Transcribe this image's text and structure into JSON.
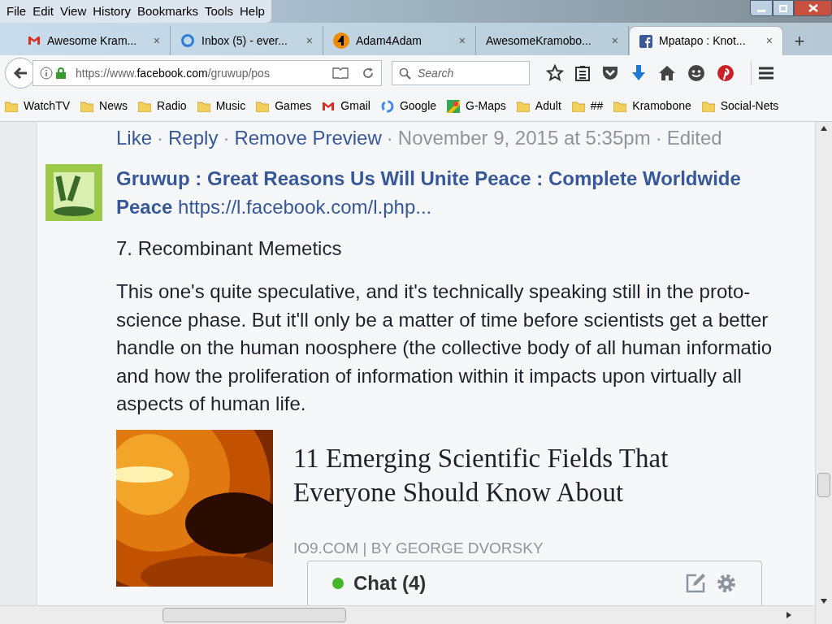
{
  "menu": [
    "File",
    "Edit",
    "View",
    "History",
    "Bookmarks",
    "Tools",
    "Help"
  ],
  "tabs": [
    {
      "title": "Awesome Kram...",
      "kind": "mail",
      "close": "×",
      "selected": false
    },
    {
      "title": "Inbox (5) - ever...",
      "kind": "ring",
      "close": "×",
      "selected": false
    },
    {
      "title": "Adam4Adam",
      "kind": "logo",
      "close": "×",
      "selected": false
    },
    {
      "title": "AwesomeKramobo...",
      "kind": "plain",
      "close": "×",
      "selected": false
    },
    {
      "title": "Mpatapo : Knot...",
      "kind": "social",
      "close": "×",
      "selected": true
    }
  ],
  "tab_new": "+",
  "url": {
    "prefix": "https://www.",
    "domain": "facebook.com",
    "path": "/gruwup/pos"
  },
  "search": {
    "placeholder": "Search"
  },
  "bookmarks": [
    {
      "label": "WatchTV",
      "kind": "folder"
    },
    {
      "label": "News",
      "kind": "folder"
    },
    {
      "label": "Radio",
      "kind": "folder"
    },
    {
      "label": "Music",
      "kind": "folder"
    },
    {
      "label": "Games",
      "kind": "folder"
    },
    {
      "label": "Gmail",
      "kind": "mail"
    },
    {
      "label": "Google",
      "kind": "search"
    },
    {
      "label": "G-Maps",
      "kind": "map"
    },
    {
      "label": "Adult",
      "kind": "folder"
    },
    {
      "label": "##",
      "kind": "folder"
    },
    {
      "label": "Kramobone",
      "kind": "folder"
    },
    {
      "label": "Social-Nets",
      "kind": "folder"
    }
  ],
  "separator": "·",
  "actions": [
    "Like",
    "Reply",
    "Remove Preview"
  ],
  "timestamp": "November 9, 2015 at 5:35pm",
  "edited": "Edited",
  "comment": {
    "author": "Gruwup : Great Reasons Us Will Unite Peace : Complete Worldwide Peace",
    "link": "https://l.facebook.com/l.php...",
    "heading": "7. Recombinant Memetics",
    "paragraph_lines": [
      "This one's quite speculative, and it's technically speaking still in the proto-",
      "science phase. But it'll only be a matter of time before scientists get a better",
      "handle on the human noosphere (the collective body of all human informatio",
      "and how the proliferation of information within it impacts upon virtually all",
      "aspects of human life."
    ]
  },
  "preview": {
    "title": "11 Emerging Scientific Fields That Everyone Should Know About",
    "source": "IO9.COM | BY GEORGE DVORSKY"
  },
  "chat": {
    "label": "Chat (4)",
    "online": true
  }
}
